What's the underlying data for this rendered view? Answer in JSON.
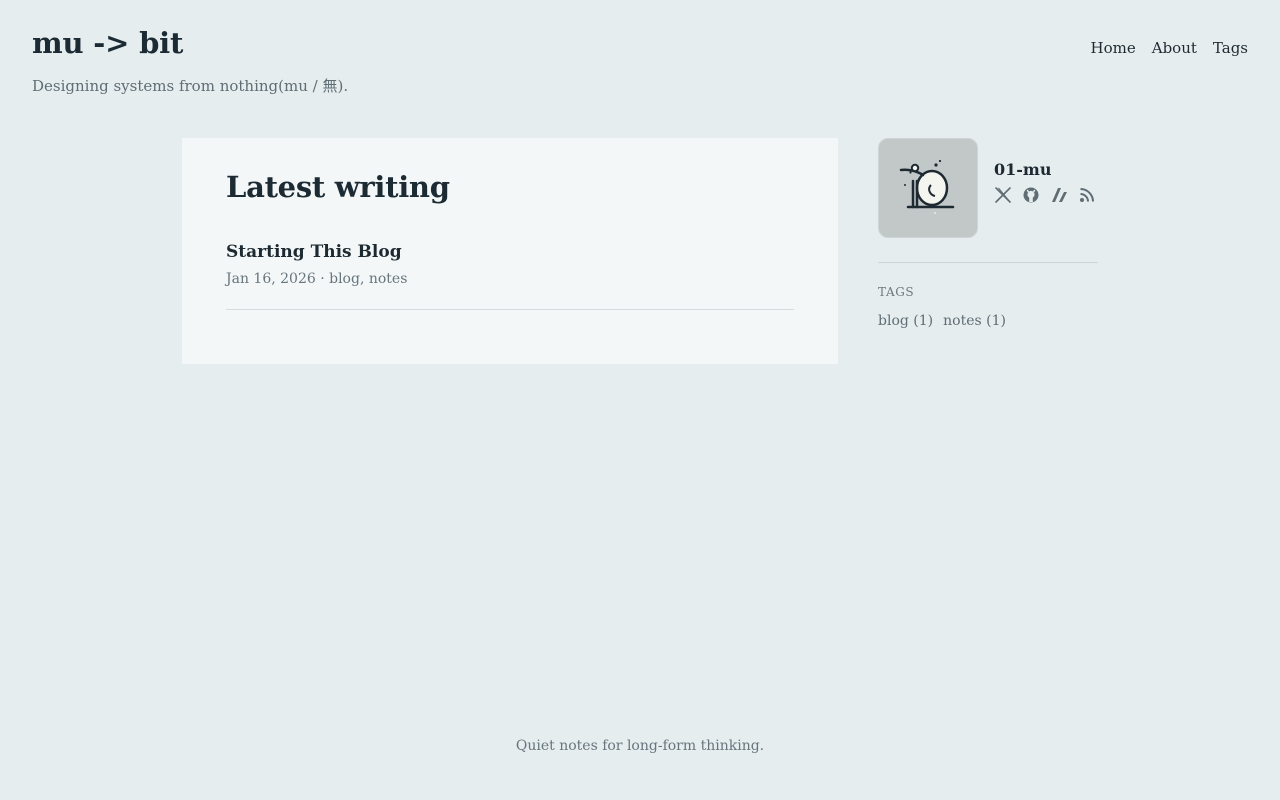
{
  "header": {
    "title": "mu -> bit",
    "subtitle": "Designing systems from nothing(mu / 無).",
    "nav": [
      {
        "label": "Home"
      },
      {
        "label": "About"
      },
      {
        "label": "Tags"
      }
    ]
  },
  "main": {
    "section_title": "Latest writing",
    "posts": [
      {
        "title": "Starting This Blog",
        "meta": "Jan 16, 2026 · blog, notes"
      }
    ]
  },
  "sidebar": {
    "profile": {
      "name": "01-mu",
      "avatar_icon": "anteater-illustration",
      "social": [
        "x-icon",
        "github-icon",
        "zenn-icon",
        "rss-icon"
      ]
    },
    "tags_heading": "TAGS",
    "tags": [
      {
        "label": "blog (1)"
      },
      {
        "label": "notes (1)"
      }
    ]
  },
  "footer": {
    "text": "Quiet notes for long-form thinking."
  },
  "colors": {
    "background": "#e5edef",
    "card": "#f3f7f8",
    "text": "#1e2a31",
    "muted": "#67757d",
    "divider": "#d5dddf"
  }
}
